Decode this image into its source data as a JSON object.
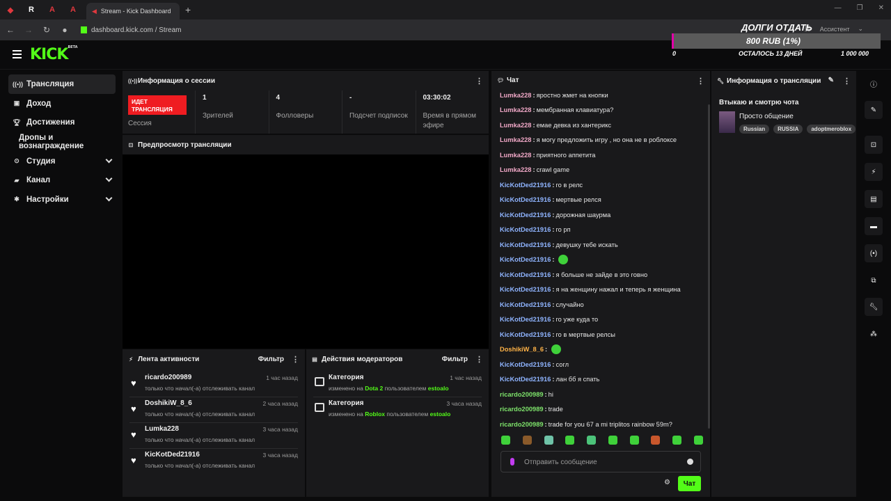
{
  "browser": {
    "tab_title": "Stream - Kick Dashboard",
    "url": "dashboard.kick.com / Stream",
    "assistant_label": "Ассистент"
  },
  "logo": {
    "text": "KICK",
    "beta": "BETA"
  },
  "donation": {
    "title": "ДОЛГИ ОТДАТЬ",
    "amount": "800 RUB (1%)",
    "min": "0",
    "remaining": "ОСТАЛОСЬ 13 ДНЕЙ",
    "max": "1 000 000",
    "progress": 0.01,
    "colors": {
      "fill": "#e200a8"
    }
  },
  "sidebar": {
    "items": [
      {
        "label": "Трансляция",
        "icon": "broadcast-icon"
      },
      {
        "label": "Доход",
        "icon": "dollar-icon"
      },
      {
        "label": "Достижения",
        "icon": "trophy-icon"
      },
      {
        "label": "Дропы и вознаграждение",
        "icon": ""
      },
      {
        "label": "Студия",
        "icon": "studio-icon"
      },
      {
        "label": "Канал",
        "icon": "channel-icon"
      },
      {
        "label": "Настройки",
        "icon": "gear-icon"
      }
    ]
  },
  "session": {
    "title": "Информация о сессии",
    "live_badge": "ИДЕТ ТРАНСЛЯЦИЯ",
    "session_label": "Сессия",
    "stats": [
      {
        "value": "1",
        "label": "Зрителей"
      },
      {
        "value": "4",
        "label": "Фолловеры"
      },
      {
        "value": "-",
        "label": "Подсчет подписок"
      },
      {
        "value": "03:30:02",
        "label": "Время в прямом эфире"
      }
    ]
  },
  "preview": {
    "title": "Предпросмотр трансляции"
  },
  "activity": {
    "title": "Лента активности",
    "filter": "Фильтр",
    "items": [
      {
        "name": "ricardo200989",
        "sub": "только что начал(-а) отслеживать канал",
        "time": "1 час назад"
      },
      {
        "name": "DoshikiW_8_6",
        "sub": "только что начал(-а) отслеживать канал",
        "time": "2 часа назад"
      },
      {
        "name": "Lumka228",
        "sub": "только что начал(-а) отслеживать канал",
        "time": "3 часа назад"
      },
      {
        "name": "KicKotDed21916",
        "sub": "только что начал(-а) отслеживать канал",
        "time": "3 часа назад"
      }
    ]
  },
  "moderators": {
    "title": "Действия модераторов",
    "filter": "Фильтр",
    "changed_to": "изменено на",
    "by_user": "пользователем",
    "items": [
      {
        "name": "Категория",
        "value": "Dota 2",
        "user": "estoalo",
        "time": "1 час назад"
      },
      {
        "name": "Категория",
        "value": "Roblox",
        "user": "estoalo",
        "time": "3 часа назад"
      }
    ]
  },
  "chat": {
    "title": "Чат",
    "placeholder": "Отправить сообщение",
    "send_label": "Чат",
    "colors": {
      "Lumka228": "#f2a9c8",
      "KicKotDed21916": "#8fb4ff",
      "DoshikiW_8_6": "#ffb347",
      "ricardo200989": "#7ee36b"
    },
    "messages": [
      {
        "user": "Lumka228",
        "text": "яростно жмет на кнопки"
      },
      {
        "user": "Lumka228",
        "text": "мембранная клавиатура?"
      },
      {
        "user": "Lumka228",
        "text": "емае девка из хантерикс"
      },
      {
        "user": "Lumka228",
        "text": "я могу предложить игру , но она не в роблоксе"
      },
      {
        "user": "Lumka228",
        "text": "приятного аппетита"
      },
      {
        "user": "Lumka228",
        "text": "crawl game"
      },
      {
        "user": "KicKotDed21916",
        "text": "го в релс"
      },
      {
        "user": "KicKotDed21916",
        "text": "мертвые релся"
      },
      {
        "user": "KicKotDed21916",
        "text": "дорожная шаурма"
      },
      {
        "user": "KicKotDed21916",
        "text": "го рп"
      },
      {
        "user": "KicKotDed21916",
        "text": "девушку тебе искать"
      },
      {
        "user": "KicKotDed21916",
        "text": "",
        "emote": true
      },
      {
        "user": "KicKotDed21916",
        "text": "я больше не зайде в это говно"
      },
      {
        "user": "KicKotDed21916",
        "text": "я на женщину нажал и теперь я женщина"
      },
      {
        "user": "KicKotDed21916",
        "text": "случайно"
      },
      {
        "user": "KicKotDed21916",
        "text": "го уже куда то"
      },
      {
        "user": "KicKotDed21916",
        "text": "го в мертвые релсы"
      },
      {
        "user": "DoshikiW_8_6",
        "text": "",
        "emote": true
      },
      {
        "user": "KicKotDed21916",
        "text": "согл"
      },
      {
        "user": "KicKotDed21916",
        "text": "лан бб я спать"
      },
      {
        "user": "ricardo200989",
        "text": "hi"
      },
      {
        "user": "ricardo200989",
        "text": "trade"
      },
      {
        "user": "ricardo200989",
        "text": "trade for you 67 a mi triplitos rainbow 59m?"
      }
    ]
  },
  "stream_info": {
    "title": "Информация о трансляции",
    "stream_title": "Втыкаю и смотрю чота",
    "category": "Просто общение",
    "tags": [
      "Russian",
      "RUSSIA",
      "adoptmeroblox"
    ]
  },
  "rail": {
    "icons": [
      "info-icon",
      "edit-icon",
      "capture-icon",
      "bolt-icon",
      "notes-icon",
      "chat-icon",
      "broadcast-icon",
      "layout-icon",
      "wrench-icon",
      "share-icon"
    ]
  }
}
